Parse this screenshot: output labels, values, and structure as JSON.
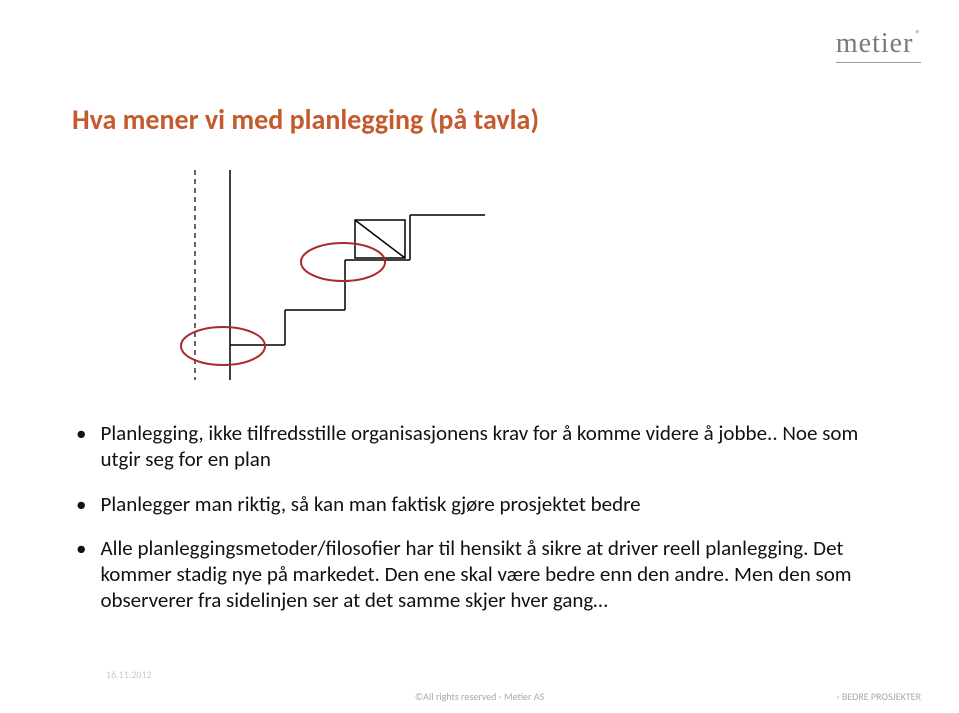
{
  "logo": {
    "text": "metier",
    "registered": "®"
  },
  "title": "Hva mener vi med planlegging (på tavla)",
  "bullets": [
    "Planlegging, ikke tilfredsstille organisasjonens krav for å komme videre å jobbe.. Noe som utgir seg for en plan",
    "Planlegger man riktig, så kan man faktisk gjøre prosjektet bedre",
    "Alle planleggingsmetoder/filosofier har til hensikt å sikre at  driver reell planlegging. Det kommer stadig nye på markedet. Den ene skal være bedre enn den andre. Men den som observerer fra sidelinjen ser at det samme skjer hver gang…"
  ],
  "footer": {
    "watermark": "16.11.2012",
    "center": "©All rights reserved - Metier AS",
    "right": "- BEDRE PROSJEKTER"
  }
}
